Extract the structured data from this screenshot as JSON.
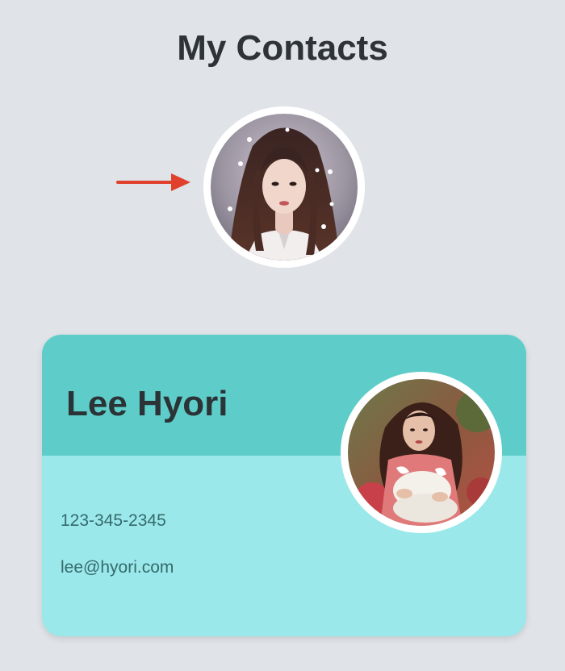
{
  "page": {
    "title": "My Contacts",
    "background_color": "#e0e4e8"
  },
  "profile": {
    "avatar_icon": "profile-photo-woman-long-dark-hair",
    "pointer_icon": "arrow-right-icon",
    "pointer_color": "#e0412c"
  },
  "contact_card": {
    "name": "Lee Hyori",
    "phone": "123-345-2345",
    "email": "lee@hyori.com",
    "avatar_icon": "contact-photo-woman-floral-jacket",
    "header_color": "#5ecdc9",
    "body_color": "#9be8ea"
  }
}
